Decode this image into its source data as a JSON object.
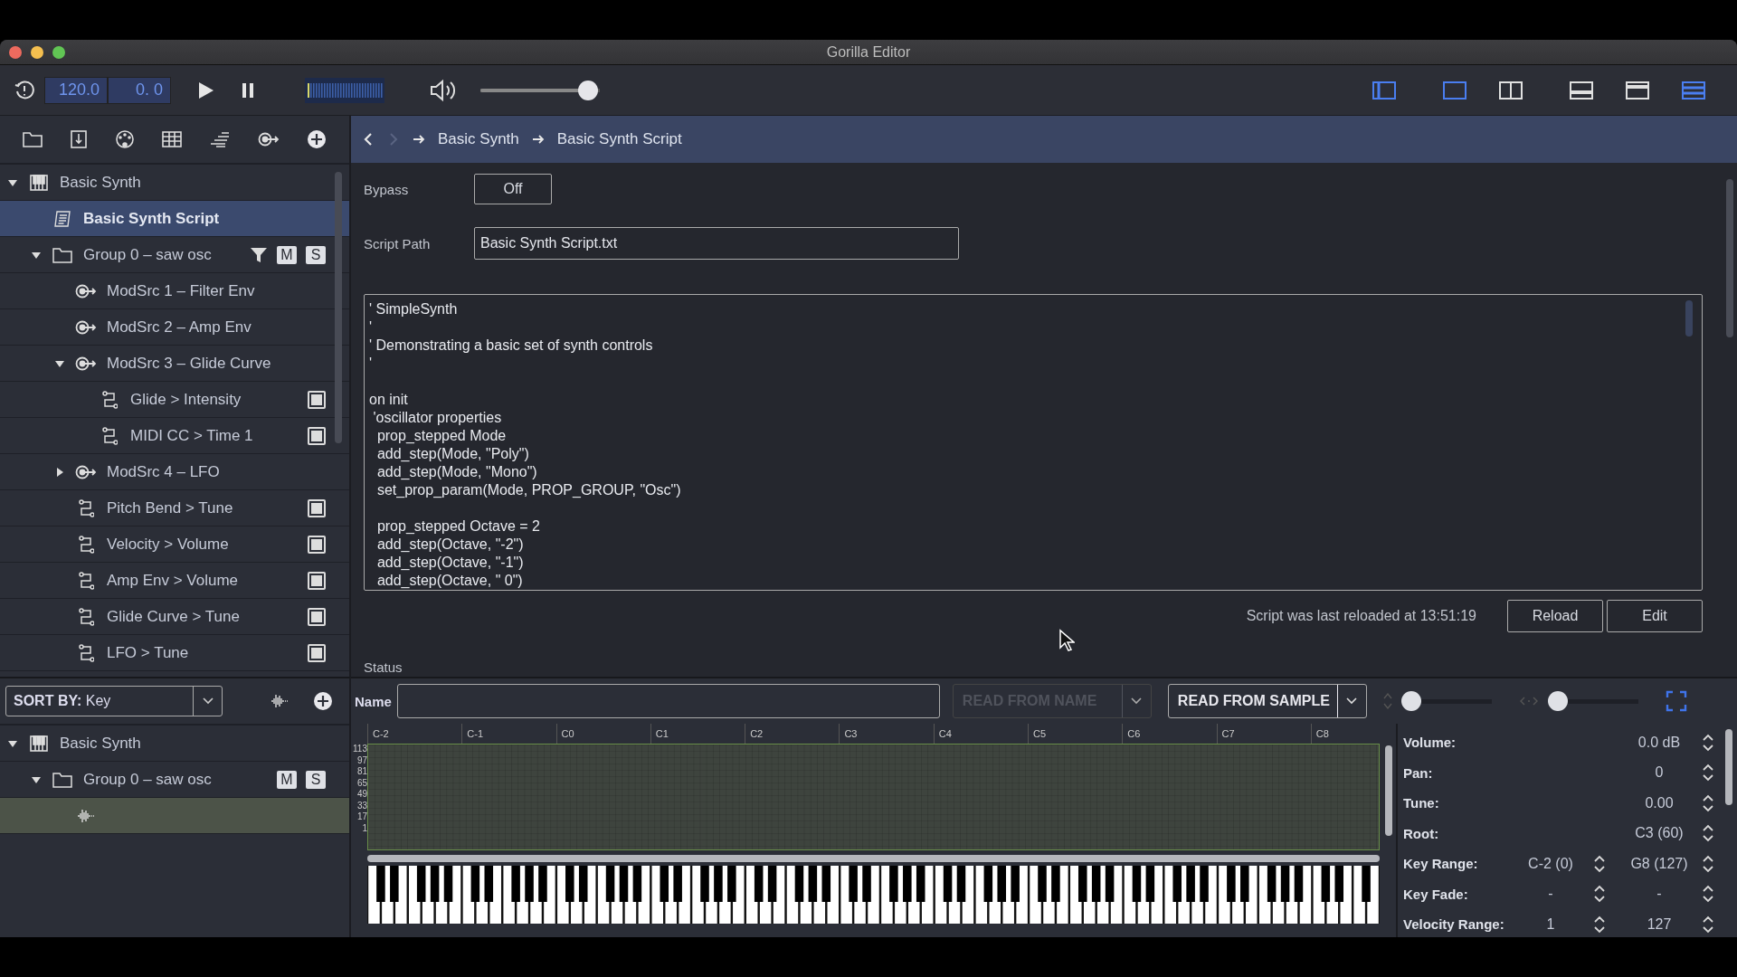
{
  "window": {
    "title": "Gorilla Editor"
  },
  "transport": {
    "tempo": "120.0",
    "position": "0. 0",
    "volume": {
      "level": 0.98
    }
  },
  "view_buttons": [
    {
      "kind": "sidebar",
      "on": true
    },
    {
      "kind": "single",
      "on": true
    },
    {
      "kind": "split",
      "on": false
    },
    {
      "kind": "bottom",
      "on": false
    },
    {
      "kind": "top",
      "on": false
    },
    {
      "kind": "stack",
      "on": true
    }
  ],
  "tree": [
    {
      "kind": "instrument",
      "label": "Basic Synth",
      "selected": false,
      "expanded": true,
      "children": [
        {
          "kind": "script",
          "label": "Basic Synth Script",
          "selected": true
        },
        {
          "kind": "group",
          "label": "Group 0 – saw osc",
          "selected": false,
          "expanded": true,
          "filtered": true,
          "buttons": [
            "M",
            "S"
          ],
          "children": [
            {
              "kind": "modsrc",
              "label": "ModSrc 1 – Filter Env",
              "selected": false
            },
            {
              "kind": "modsrc",
              "label": "ModSrc 2 – Amp Env",
              "selected": false
            },
            {
              "kind": "modsrc",
              "label": "ModSrc 3 – Glide Curve",
              "selected": false,
              "expanded": true,
              "children": [
                {
                  "kind": "route",
                  "label": "Glide > Intensity",
                  "selected": false,
                  "checked": true
                },
                {
                  "kind": "route",
                  "label": "MIDI CC > Time 1",
                  "selected": false,
                  "checked": true
                }
              ]
            },
            {
              "kind": "modsrc",
              "label": "ModSrc 4 – LFO",
              "selected": false,
              "expanded": false
            },
            {
              "kind": "route",
              "label": "Pitch Bend > Tune",
              "selected": false,
              "checked": true
            },
            {
              "kind": "route",
              "label": "Velocity > Volume",
              "selected": false,
              "checked": true
            },
            {
              "kind": "route",
              "label": "Amp Env > Volume",
              "selected": false,
              "checked": true
            },
            {
              "kind": "route",
              "label": "Glide Curve > Tune",
              "selected": false,
              "checked": true
            },
            {
              "kind": "route",
              "label": "LFO > Tune",
              "selected": false,
              "checked": true
            }
          ]
        }
      ]
    }
  ],
  "breadcrumb": [
    "Basic Synth",
    "Basic Synth Script"
  ],
  "script": {
    "bypass_label": "Bypass",
    "bypass": "Off",
    "path_label": "Script Path",
    "path": "Basic Synth Script.txt",
    "code": "' SimpleSynth\n'\n' Demonstrating a basic set of synth controls\n'\n\non init\n 'oscillator properties\n  prop_stepped Mode\n  add_step(Mode, \"Poly\")\n  add_step(Mode, \"Mono\")\n  set_prop_param(Mode, PROP_GROUP, \"Osc\")\n\n  prop_stepped Octave = 2\n  add_step(Octave, \"-2\")\n  add_step(Octave, \"-1\")\n  add_step(Octave, \" 0\")",
    "reload_status": "Script was last reloaded at 13:51:19",
    "buttons": [
      "Reload",
      "Edit"
    ],
    "status_label": "Status"
  },
  "sample_tree": {
    "sort": "**SORT BY:** Key",
    "items": [
      {
        "kind": "instrument",
        "label": "Basic Synth",
        "selected": false,
        "expanded": true,
        "children": [
          {
            "kind": "group",
            "label": "Group 0 – saw osc",
            "selected": false,
            "expanded": true,
            "buttons": [
              "M",
              "S"
            ],
            "children": [
              {
                "kind": "sample",
                "selected": true
              }
            ]
          }
        ]
      }
    ]
  },
  "sample_toolbar": {
    "name_label": "Name",
    "dropdowns": [
      {
        "label": "READ FROM NAME",
        "disabled": true
      },
      {
        "label": "READ FROM SAMPLE",
        "disabled": false
      }
    ],
    "sliders": [
      {
        "level": 0
      },
      {
        "level": 0
      }
    ]
  },
  "keymap": {
    "notes": [
      "C-2",
      "C-1",
      "C0",
      "C1",
      "C2",
      "C3",
      "C4",
      "C5",
      "C6",
      "C7",
      "C8"
    ],
    "velocities": [
      "113",
      "97",
      "81",
      "65",
      "49",
      "33",
      "17",
      "1"
    ]
  },
  "properties": [
    {
      "label": "Volume:",
      "values": [
        "0.0 dB"
      ]
    },
    {
      "label": "Pan:",
      "values": [
        "0"
      ]
    },
    {
      "label": "Tune:",
      "values": [
        "0.00"
      ]
    },
    {
      "label": "Root:",
      "values": [
        "C3 (60)"
      ]
    },
    {
      "label": "Key Range:",
      "values": [
        "C-2 (0)",
        "G8 (127)"
      ]
    },
    {
      "label": "Key Fade:",
      "values": [
        "-",
        "-"
      ]
    },
    {
      "label": "Velocity Range:",
      "values": [
        "1",
        "127"
      ]
    }
  ]
}
